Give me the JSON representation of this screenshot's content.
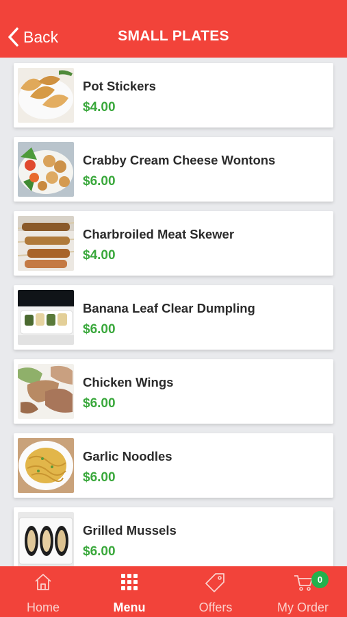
{
  "header": {
    "back_label": "Back",
    "title": "SMALL PLATES",
    "background_color": "#f2433a"
  },
  "items": [
    {
      "name": "Pot Stickers",
      "price": "$4.00",
      "image_icon": "potstickers-photo"
    },
    {
      "name": "Crabby Cream Cheese Wontons",
      "price": "$6.00",
      "image_icon": "wontons-photo"
    },
    {
      "name": "Charbroiled Meat Skewer",
      "price": "$4.00",
      "image_icon": "skewer-photo"
    },
    {
      "name": "Banana Leaf Clear Dumpling",
      "price": "$6.00",
      "image_icon": "dumpling-photo"
    },
    {
      "name": "Chicken Wings",
      "price": "$6.00",
      "image_icon": "wings-photo"
    },
    {
      "name": "Garlic Noodles",
      "price": "$6.00",
      "image_icon": "noodles-photo"
    },
    {
      "name": "Grilled Mussels",
      "price": "$6.00",
      "image_icon": "mussels-photo"
    }
  ],
  "tabbar": {
    "tabs": [
      {
        "label": "Home",
        "icon": "home-icon"
      },
      {
        "label": "Menu",
        "icon": "grid-icon",
        "active": true
      },
      {
        "label": "Offers",
        "icon": "tag-icon"
      },
      {
        "label": "My Order",
        "icon": "cart-icon"
      }
    ],
    "cart_count": "0"
  },
  "colors": {
    "accent": "#f2433a",
    "price": "#3aa83c",
    "badge": "#22b14c"
  }
}
